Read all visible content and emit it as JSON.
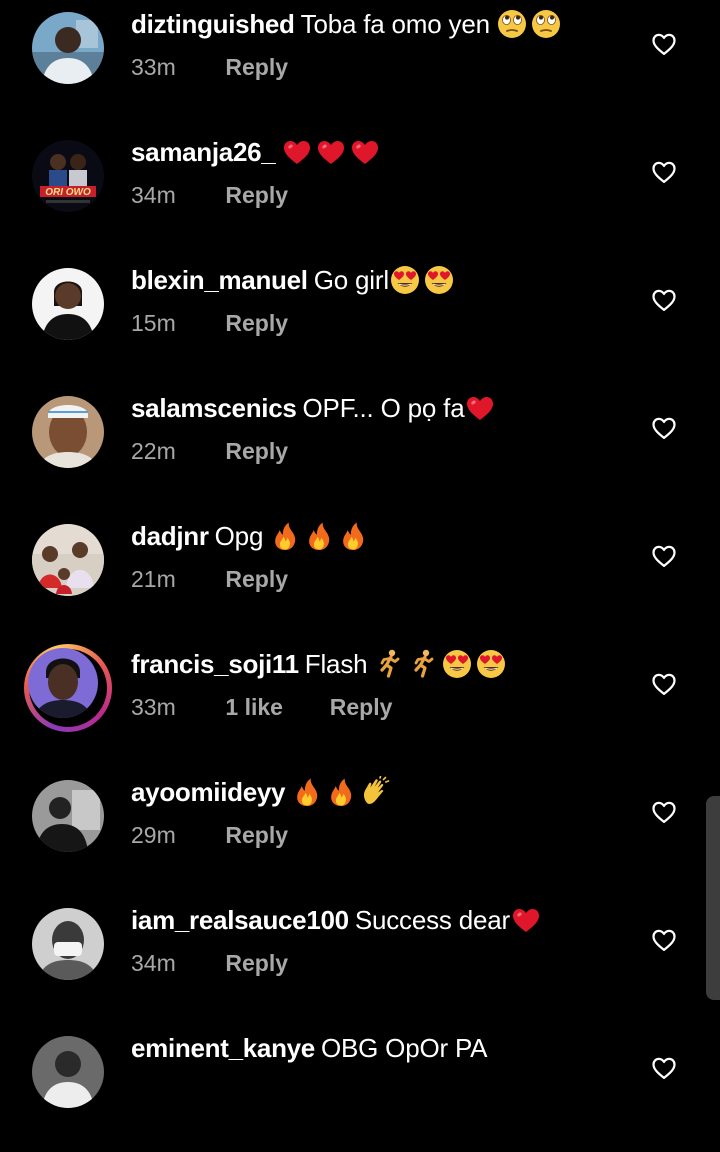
{
  "comments": [
    {
      "username": "diztinguished",
      "text": "Toba fa omo yen",
      "emojis": [
        "face-with-rolling-eyes",
        "face-with-rolling-eyes"
      ],
      "time": "33m",
      "likes": "",
      "reply_label": "Reply"
    },
    {
      "username": "samanja26_",
      "text": "",
      "emojis": [
        "red-heart",
        "red-heart",
        "red-heart"
      ],
      "time": "34m",
      "likes": "",
      "reply_label": "Reply",
      "avatar_caption": "ORI OWO"
    },
    {
      "username": "blexin_manuel",
      "text": "Go girl",
      "emojis": [
        "heart-eyes",
        "heart-eyes"
      ],
      "time": "15m",
      "likes": "",
      "reply_label": "Reply"
    },
    {
      "username": "salamscenics",
      "text": "OPF... O pọ fa",
      "emojis": [
        "red-heart"
      ],
      "time": "22m",
      "likes": "",
      "reply_label": "Reply"
    },
    {
      "username": "dadjnr",
      "text": "Opg",
      "emojis": [
        "fire",
        "fire",
        "fire"
      ],
      "time": "21m",
      "likes": "",
      "reply_label": "Reply"
    },
    {
      "username": "francis_soji11",
      "text": "Flash",
      "emojis": [
        "person-running",
        "person-running",
        "heart-eyes",
        "heart-eyes"
      ],
      "time": "33m",
      "likes": "1 like",
      "reply_label": "Reply"
    },
    {
      "username": "ayoomiideyy",
      "text": "",
      "emojis": [
        "fire",
        "fire",
        "clapping-hands"
      ],
      "time": "29m",
      "likes": "",
      "reply_label": "Reply"
    },
    {
      "username": "iam_realsauce100",
      "text": "Success dear",
      "emojis": [
        "red-heart"
      ],
      "time": "34m",
      "likes": "",
      "reply_label": "Reply"
    },
    {
      "username": "eminent_kanye",
      "text": "OBG OpOr PA",
      "emojis": [],
      "time": "",
      "likes": "",
      "reply_label": ""
    }
  ],
  "colors": {
    "background": "#000000",
    "primary_text": "#ffffff",
    "secondary_text": "#a8a8a8",
    "heart_emoji": "#e0162b"
  }
}
